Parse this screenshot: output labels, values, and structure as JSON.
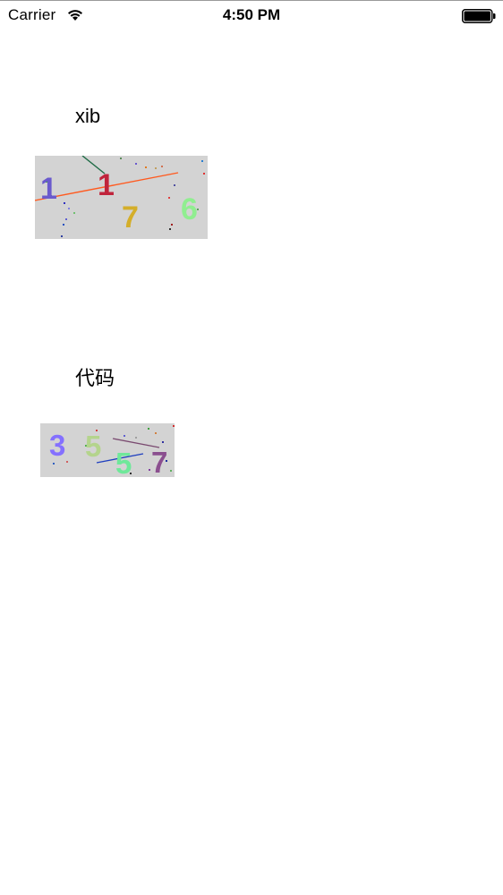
{
  "status_bar": {
    "carrier": "Carrier",
    "time": "4:50 PM",
    "wifi_icon": "wifi-icon",
    "battery_icon": "battery-full-icon"
  },
  "xib_section": {
    "label": "xib",
    "captcha": {
      "background": "#d3d3d3",
      "characters": [
        {
          "char": "1",
          "color": "#6a5acd"
        },
        {
          "char": "1",
          "color": "#c0243c"
        },
        {
          "char": "7",
          "color": "#d4ae2a"
        },
        {
          "char": "6",
          "color": "#90ee90"
        }
      ],
      "line_colors": [
        "#ff5a1f",
        "#1e6b45"
      ]
    }
  },
  "code_section": {
    "label": "代码",
    "captcha": {
      "background": "#d3d3d3",
      "characters": [
        {
          "char": "3",
          "color": "#8470ff"
        },
        {
          "char": "5",
          "color": "#b4d48c"
        },
        {
          "char": "5",
          "color": "#6fe89a"
        },
        {
          "char": "7",
          "color": "#8b4f8f"
        }
      ],
      "line_colors": [
        "#1f3fbf",
        "#7a4a70"
      ]
    }
  }
}
